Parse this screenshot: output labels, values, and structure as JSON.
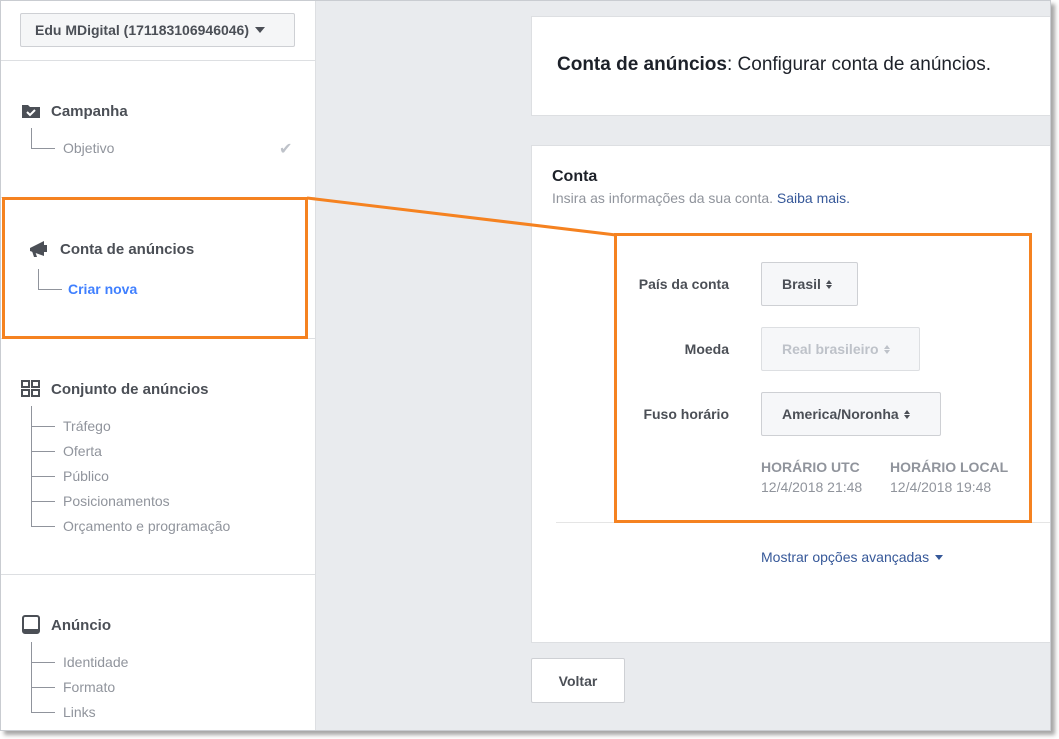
{
  "account_selector": {
    "label": "Edu MDigital (171183106946046)"
  },
  "sidebar": {
    "campanha": {
      "label": "Campanha",
      "items": [
        {
          "label": "Objetivo",
          "done": true
        }
      ]
    },
    "conta": {
      "label": "Conta de anúncios",
      "items": [
        {
          "label": "Criar nova",
          "active": true
        }
      ]
    },
    "conjunto": {
      "label": "Conjunto de anúncios",
      "items": [
        {
          "label": "Tráfego"
        },
        {
          "label": "Oferta"
        },
        {
          "label": "Público"
        },
        {
          "label": "Posicionamentos"
        },
        {
          "label": "Orçamento e programação"
        }
      ]
    },
    "anuncio": {
      "label": "Anúncio",
      "items": [
        {
          "label": "Identidade"
        },
        {
          "label": "Formato"
        },
        {
          "label": "Links"
        }
      ]
    }
  },
  "header": {
    "title_bold": "Conta de anúncios",
    "title_rest": ": Configurar conta de anúncios."
  },
  "conta_card": {
    "title": "Conta",
    "description": "Insira as informações da sua conta.",
    "learn_more": "Saiba mais.",
    "fields": {
      "pais": {
        "label": "País da conta",
        "value": "Brasil"
      },
      "moeda": {
        "label": "Moeda",
        "value": "Real brasileiro",
        "disabled": true
      },
      "fuso": {
        "label": "Fuso horário",
        "value": "America/Noronha"
      }
    },
    "timezone": {
      "utc_label": "HORÁRIO UTC",
      "utc_value": "12/4/2018 21:48",
      "local_label": "HORÁRIO LOCAL",
      "local_value": "12/4/2018 19:48"
    },
    "advanced_link": "Mostrar opções avançadas"
  },
  "back_button": "Voltar",
  "colors": {
    "highlight": "#f58220",
    "link": "#365899",
    "active": "#4080ff"
  },
  "icons": [
    "chevron-down-icon",
    "folder-check-icon",
    "checkmark-icon",
    "megaphone-icon",
    "grid-icon",
    "tablet-icon",
    "updown-arrows-icon"
  ]
}
